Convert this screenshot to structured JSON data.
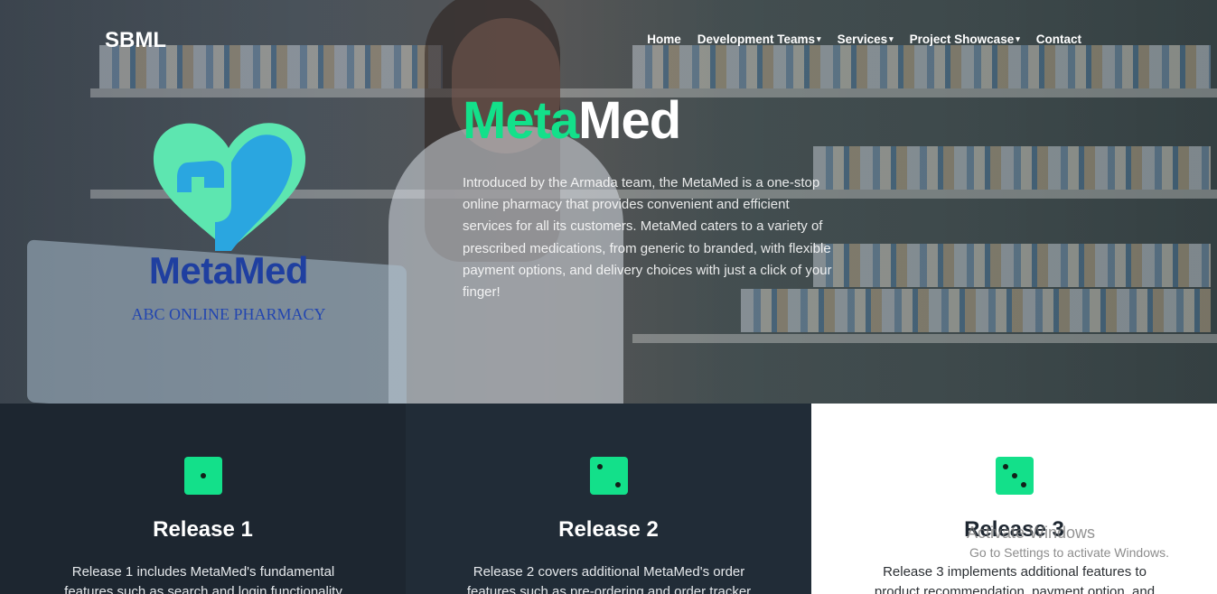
{
  "brand": "SBML",
  "nav": {
    "items": [
      {
        "label": "Home",
        "dropdown": false
      },
      {
        "label": "Development Teams",
        "dropdown": true
      },
      {
        "label": "Services",
        "dropdown": true
      },
      {
        "label": "Project Showcase",
        "dropdown": true
      },
      {
        "label": "Contact",
        "dropdown": false
      }
    ],
    "caret": "▾"
  },
  "logo": {
    "title": "MetaMed",
    "subtitle": "ABC ONLINE PHARMACY",
    "icon": "heart-logo-icon"
  },
  "hero": {
    "title_accent": "Meta",
    "title_rest": "Med",
    "description": "Introduced by the Armada team, the MetaMed is a one-stop online pharmacy that provides convenient and efficient services for all its customers. MetaMed caters to a variety of prescribed medications, from generic to branded, with flexible payment options, and delivery choices with just a click of your finger!"
  },
  "releases": [
    {
      "title": "Release 1",
      "icon": "dice-one-icon",
      "text": "Release 1 includes MetaMed's fundamental features such as search and login functionality"
    },
    {
      "title": "Release 2",
      "icon": "dice-two-icon",
      "text": "Release 2 covers additional MetaMed's order features such as pre-ordering and order tracker"
    },
    {
      "title": "Release 3",
      "icon": "dice-three-icon",
      "text": "Release 3 implements additional features to product recommendation, payment option, and"
    }
  ],
  "watermark": {
    "title": "Activate Windows",
    "subtitle": "Go to Settings to activate Windows."
  },
  "colors": {
    "accent": "#13e08a",
    "dark_bg": "#1d2630",
    "logo_blue": "#1f3fa0",
    "logo_teal": "#5de6b0",
    "logo_sky": "#2aa6e0"
  }
}
